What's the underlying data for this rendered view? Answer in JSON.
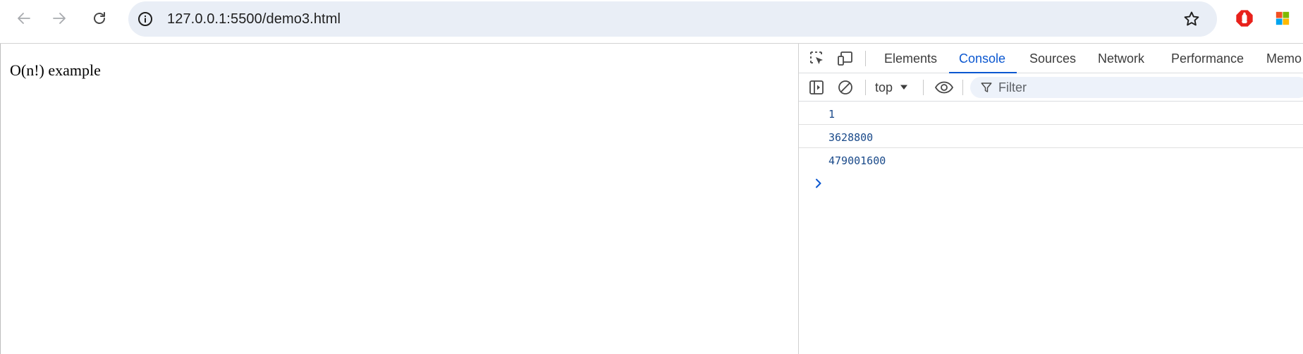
{
  "browser": {
    "url": "127.0.0.1:5500/demo3.html",
    "icons": {
      "back": "arrow-left-icon",
      "forward": "arrow-right-icon",
      "reload": "reload-icon",
      "site_info": "info-icon",
      "bookmark": "star-icon",
      "extension_1": "red-hand-stop-icon",
      "extension_2": "windows-logo-icon"
    }
  },
  "page": {
    "text": "O(n!) example"
  },
  "devtools": {
    "tabs": [
      {
        "label": "Elements",
        "active": false
      },
      {
        "label": "Console",
        "active": true
      },
      {
        "label": "Sources",
        "active": false
      },
      {
        "label": "Network",
        "active": false
      },
      {
        "label": "Performance",
        "active": false
      },
      {
        "label": "Memo",
        "active": false
      }
    ],
    "context": "top",
    "filter_placeholder": "Filter",
    "console_messages": [
      "1",
      "3628800",
      "479001600"
    ],
    "accent_color": "#0b57d0"
  }
}
